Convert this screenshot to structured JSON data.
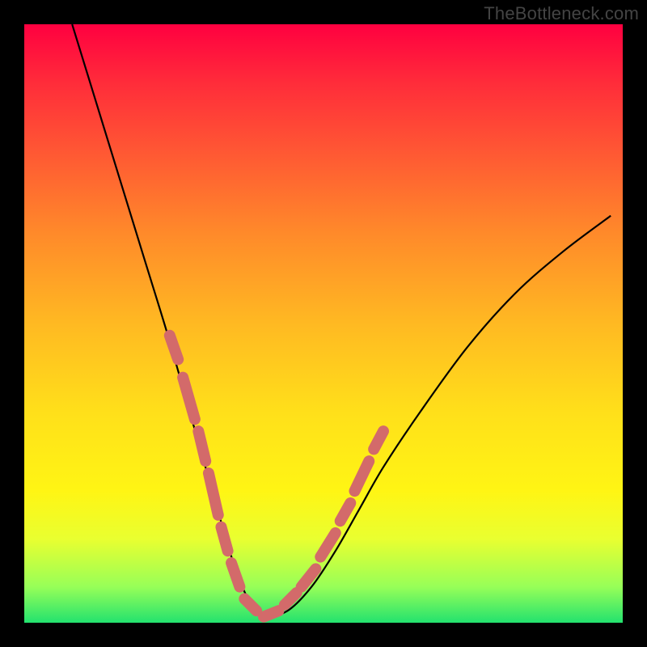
{
  "credit_text": "TheBottleneck.com",
  "colors": {
    "page_bg": "#000000",
    "gradient_top": "#ff0040",
    "gradient_bottom": "#23e26e",
    "curve_stroke": "#000000",
    "dash_stroke": "#d36a6a"
  },
  "chart_data": {
    "type": "line",
    "title": "",
    "xlabel": "",
    "ylabel": "",
    "xlim": [
      0,
      100
    ],
    "ylim": [
      0,
      100
    ],
    "legend": false,
    "grid": false,
    "note": "V-shaped curve over rainbow gradient; axis ticks not printed, values estimated from pixel position as percent of plot area (y=0 at bottom, x=0 at left).",
    "series": [
      {
        "name": "curve",
        "x": [
          8,
          12,
          16,
          20,
          24,
          28,
          30,
          32,
          34,
          36,
          38,
          40,
          44,
          48,
          52,
          56,
          60,
          66,
          74,
          82,
          90,
          98
        ],
        "y": [
          100,
          87,
          74,
          61,
          48,
          34,
          27,
          20,
          13,
          7,
          3,
          1,
          2,
          6,
          12,
          19,
          26,
          35,
          46,
          55,
          62,
          68
        ]
      }
    ],
    "dash_segments_left": [
      {
        "x": [
          24.3,
          25.7
        ],
        "y": [
          48,
          44
        ]
      },
      {
        "x": [
          26.5,
          28.5
        ],
        "y": [
          41,
          34
        ]
      },
      {
        "x": [
          29.1,
          30.3
        ],
        "y": [
          32,
          27
        ]
      },
      {
        "x": [
          30.8,
          32.4
        ],
        "y": [
          25,
          18
        ]
      },
      {
        "x": [
          32.9,
          34.0
        ],
        "y": [
          16,
          12
        ]
      },
      {
        "x": [
          34.6,
          36.0
        ],
        "y": [
          10,
          6
        ]
      },
      {
        "x": [
          36.8,
          38.8
        ],
        "y": [
          4,
          2
        ]
      }
    ],
    "dash_segments_right": [
      {
        "x": [
          40.0,
          42.5
        ],
        "y": [
          1,
          2
        ]
      },
      {
        "x": [
          43.5,
          45.5
        ],
        "y": [
          3,
          5
        ]
      },
      {
        "x": [
          46.3,
          48.7
        ],
        "y": [
          6,
          9
        ]
      },
      {
        "x": [
          49.5,
          52.0
        ],
        "y": [
          11,
          15
        ]
      },
      {
        "x": [
          52.8,
          54.5
        ],
        "y": [
          17,
          20
        ]
      },
      {
        "x": [
          55.2,
          57.6
        ],
        "y": [
          22,
          27
        ]
      },
      {
        "x": [
          58.4,
          60.0
        ],
        "y": [
          29,
          32
        ]
      }
    ]
  }
}
